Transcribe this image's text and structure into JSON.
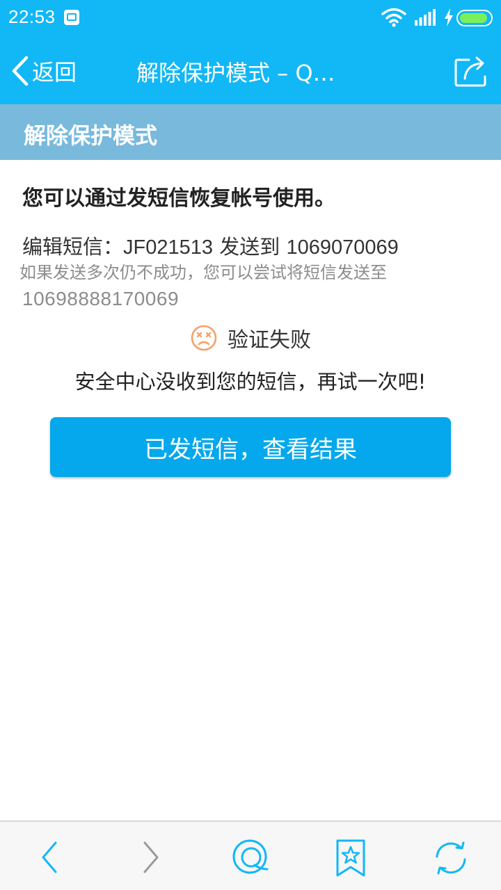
{
  "status_bar": {
    "time": "22:53",
    "battery_level": 0.92,
    "battery_color": "#7af05a"
  },
  "nav": {
    "back_label": "返回",
    "title": "解除保护模式 – Q…"
  },
  "section": {
    "title": "解除保护模式"
  },
  "content": {
    "instruction": "您可以通过发短信恢复帐号使用。",
    "sms_prefix": "编辑短信：",
    "sms_code": "JF021513",
    "sms_send_to": " 发送到 ",
    "sms_number": "1069070069",
    "fallback_hint": "如果发送多次仍不成功，您可以尝试将短信发送至",
    "fallback_number": "10698888170069",
    "verify_status": "验证失败",
    "verify_message": "安全中心没收到您的短信，再试一次吧!",
    "action_button": "已发短信，查看结果"
  },
  "icons": {
    "back": "chevron-left-icon",
    "share": "share-icon",
    "sad_face": "sad-face-icon",
    "toolbar": [
      "back-arrow-icon",
      "forward-arrow-icon",
      "qq-bubble-icon",
      "bookmark-star-icon",
      "refresh-icon"
    ]
  },
  "colors": {
    "brand_blue": "#12b7f5",
    "section_blue": "#78b9dc",
    "button_blue": "#05a8ec",
    "fail_orange": "#f5a06a"
  }
}
